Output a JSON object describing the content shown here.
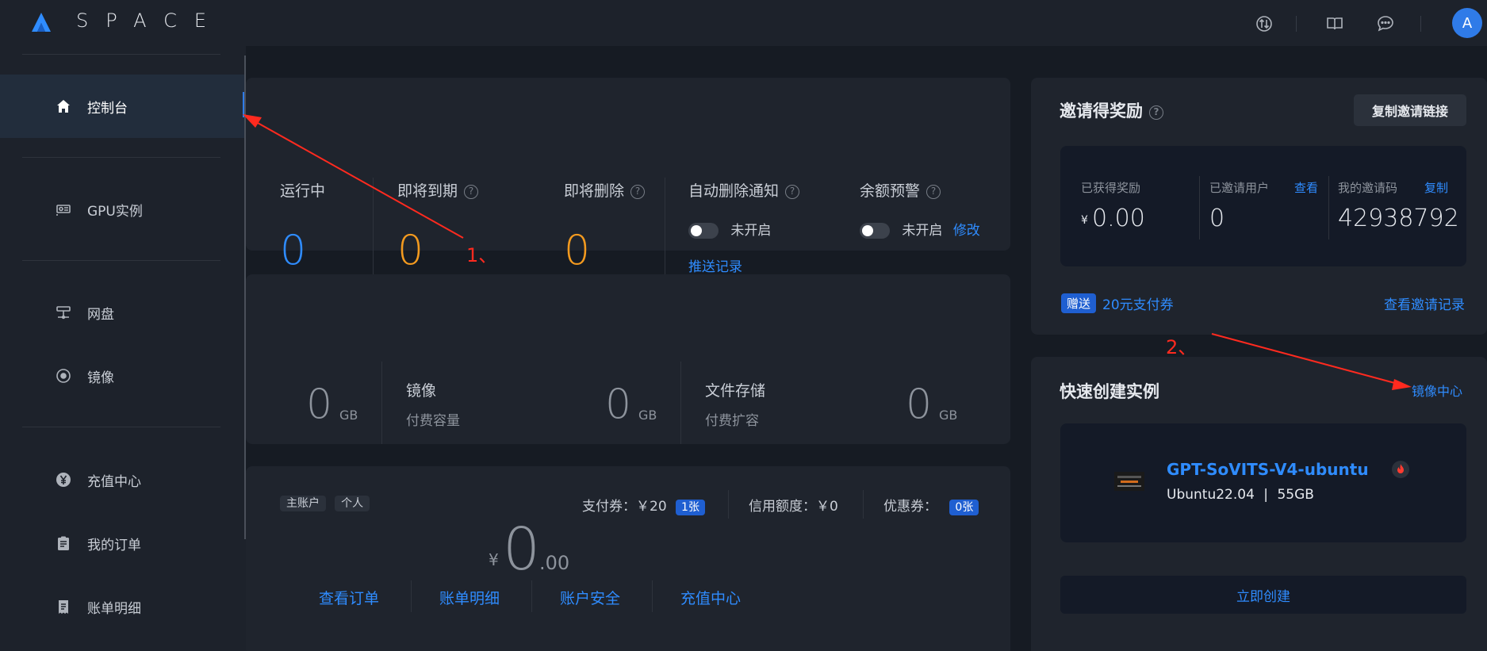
{
  "brand": {
    "logo_text": "SPACE"
  },
  "header": {
    "icons": [
      "transfer-icon",
      "book-icon",
      "chat-icon"
    ],
    "avatar_letter": "A"
  },
  "sidebar": {
    "items": [
      {
        "label": "控制台",
        "icon": "home-icon",
        "active": true
      },
      {
        "label": "GPU实例",
        "icon": "gpu-icon"
      },
      {
        "label": "网盘",
        "icon": "network-disk-icon"
      },
      {
        "label": "镜像",
        "icon": "image-icon"
      },
      {
        "label": "充值中心",
        "icon": "yen-icon"
      },
      {
        "label": "我的订单",
        "icon": "clipboard-icon"
      },
      {
        "label": "账单明细",
        "icon": "bill-icon"
      }
    ]
  },
  "instances": {
    "running_label": "运行中",
    "running_value": "0",
    "expiring_label": "即将到期",
    "expiring_value": "0",
    "deleting_label": "即将删除",
    "deleting_value": "0",
    "auto_delete_label": "自动删除通知",
    "auto_delete_status": "未开启",
    "push_record_link": "推送记录",
    "balance_alert_label": "余额预警",
    "balance_alert_status": "未开启",
    "edit_link": "修改"
  },
  "storage": {
    "first_value": "0",
    "first_unit": "GB",
    "image_title": "镜像",
    "image_sub": "付费容量",
    "image_value": "0",
    "image_unit": "GB",
    "file_title": "文件存储",
    "file_sub": "付费扩容",
    "file_value": "0",
    "file_unit": "GB"
  },
  "account": {
    "tag_main": "主账户",
    "tag_personal": "个人",
    "coupon_label": "支付券：￥20",
    "coupon_count": "1张",
    "credit_label": "信用额度：￥0",
    "discount_label": "优惠券：",
    "discount_count": "0张",
    "balance_symbol": "¥",
    "balance_int": "0",
    "balance_dec": ".00",
    "links": [
      "查看订单",
      "账单明细",
      "账户安全",
      "充值中心"
    ]
  },
  "invite": {
    "title": "邀请得奖励",
    "copy_button": "复制邀请链接",
    "earned_label": "已获得奖励",
    "earned_symbol": "¥",
    "earned_value": "0.00",
    "invited_label": "已邀请用户",
    "invited_view": "查看",
    "invited_value": "0",
    "code_label": "我的邀请码",
    "code_copy": "复制",
    "code_value": "42938792",
    "gift_badge": "赠送",
    "gift_text": "20元支付券",
    "records_link": "查看邀请记录"
  },
  "quick": {
    "title": "快速创建实例",
    "mirror_center": "镜像中心",
    "image_name": "GPT-SoVITS-V4-ubuntu",
    "image_os": "Ubuntu22.04",
    "image_sep": "|",
    "image_size": "55GB",
    "create_button": "立即创建"
  },
  "annotations": {
    "label_1": "1、",
    "label_2": "2、",
    "color": "#ff2a1f"
  },
  "colors": {
    "accent": "#2f8cff",
    "warning": "#f39a1f",
    "background": "#161b23",
    "card": "#1f242d"
  }
}
